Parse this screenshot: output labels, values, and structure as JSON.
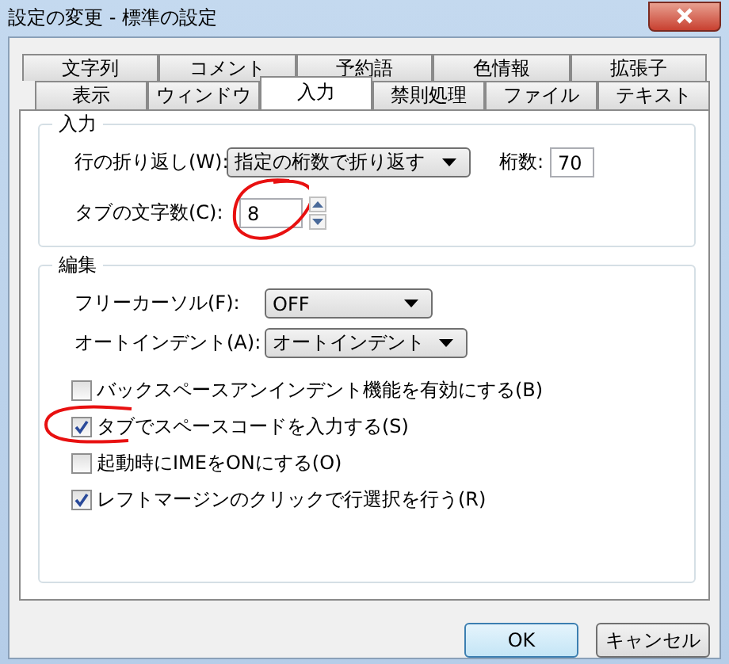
{
  "window": {
    "title": "設定の変更 - 標準の設定"
  },
  "tab_rows": [
    [
      {
        "label": "文字列",
        "selected": false
      },
      {
        "label": "コメント",
        "selected": false
      },
      {
        "label": "予約語",
        "selected": false
      },
      {
        "label": "色情報",
        "selected": false
      },
      {
        "label": "拡張子",
        "selected": false
      }
    ],
    [
      {
        "label": "表示",
        "selected": false
      },
      {
        "label": "ウィンドウ",
        "selected": false
      },
      {
        "label": "入力",
        "selected": true
      },
      {
        "label": "禁則処理",
        "selected": false
      },
      {
        "label": "ファイル",
        "selected": false
      },
      {
        "label": "テキスト",
        "selected": false
      }
    ]
  ],
  "input_group": {
    "title": "入力",
    "wrap_label": "行の折り返し(W):",
    "wrap_value": "指定の桁数で折り返す",
    "columns_label": "桁数:",
    "columns_value": "70",
    "tab_width_label": "タブの文字数(C):",
    "tab_width_value": "8",
    "tab_width_circled": true
  },
  "edit_group": {
    "title": "編集",
    "free_cursor_label": "フリーカーソル(F):",
    "free_cursor_value": "OFF",
    "auto_indent_label": "オートインデント(A):",
    "auto_indent_value": "オートインデント",
    "checkboxes": [
      {
        "label": "バックスペースアンインデント機能を有効にする(B)",
        "checked": false,
        "circled": false
      },
      {
        "label": "タブでスペースコードを入力する(S)",
        "checked": true,
        "circled": true
      },
      {
        "label": "起動時にIMEをONにする(O)",
        "checked": false,
        "circled": false
      },
      {
        "label": "レフトマージンのクリックで行選択を行う(R)",
        "checked": true,
        "circled": false
      }
    ]
  },
  "buttons": [
    {
      "label": "OK",
      "default": true
    },
    {
      "label": "キャンセル",
      "default": false
    }
  ]
}
